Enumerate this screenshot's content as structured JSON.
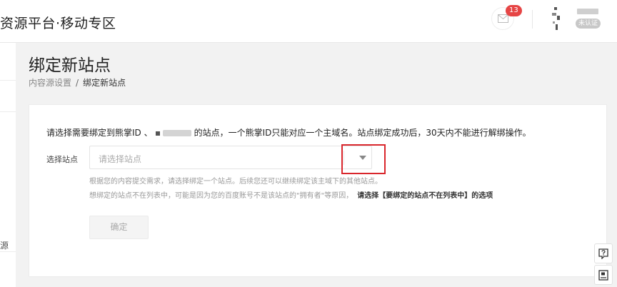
{
  "header": {
    "brand": "资源平台·移动专区",
    "message_count": "13",
    "user_badge": "未认证"
  },
  "sidebar": {
    "fragment": "源"
  },
  "page": {
    "title": "绑定新站点",
    "breadcrumb": {
      "parent": "内容源设置",
      "separator": "/",
      "current": "绑定新站点"
    }
  },
  "form": {
    "intro_prefix": "请选择需要绑定到熊掌ID 、",
    "intro_suffix": "的站点，一个熊掌ID只能对应一个主域名。站点绑定成功后，30天内不能进行解绑操作。",
    "site_label": "选择站点",
    "site_placeholder": "请选择站点",
    "hint_1": "根据您的内容提交需求，请选择绑定一个站点。后续您还可以继续绑定该主域下的其他站点。",
    "hint_2": "想绑定的站点不在列表中，可能是因为您的百度账号不是该站点的\"拥有者\"等原因，",
    "hint_2_link": "请选择【要绑定的站点不在列表中】的选项",
    "confirm_label": "确定"
  },
  "colors": {
    "badge_red": "#e64545",
    "highlight_red": "#d9262c"
  },
  "icons": {
    "message": "mail-icon",
    "dropdown": "caret-down-icon",
    "help": "help-icon",
    "feedback": "feedback-icon"
  }
}
